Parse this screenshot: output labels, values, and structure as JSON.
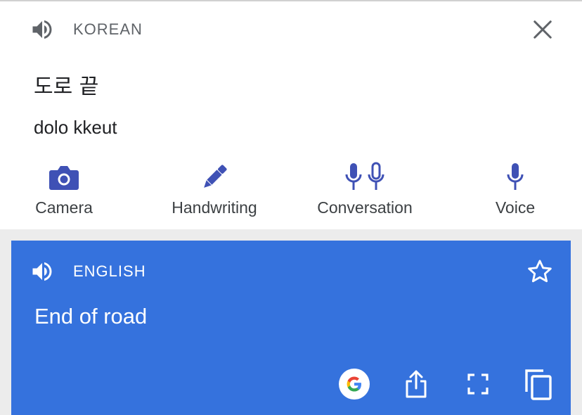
{
  "source": {
    "language": "KOREAN",
    "text": "도로 끝",
    "romanization": "dolo kkeut",
    "icons": {
      "speak": "speaker-icon",
      "close": "close-icon"
    }
  },
  "tools": [
    {
      "label": "Camera",
      "icon": "camera-icon"
    },
    {
      "label": "Handwriting",
      "icon": "pen-icon"
    },
    {
      "label": "Conversation",
      "icon": "double-mic-icon"
    },
    {
      "label": "Voice",
      "icon": "mic-icon"
    }
  ],
  "target": {
    "language": "ENGLISH",
    "text": "End of road",
    "icons": {
      "speak": "speaker-icon",
      "favorite": "star-icon",
      "google": "google-icon",
      "share": "share-icon",
      "fullscreen": "fullscreen-icon",
      "copy": "copy-icon"
    }
  },
  "colors": {
    "accent": "#3572dd",
    "tool_icon": "#3f51b5",
    "source_bg": "#ffffff",
    "page_bg": "#ececec"
  }
}
